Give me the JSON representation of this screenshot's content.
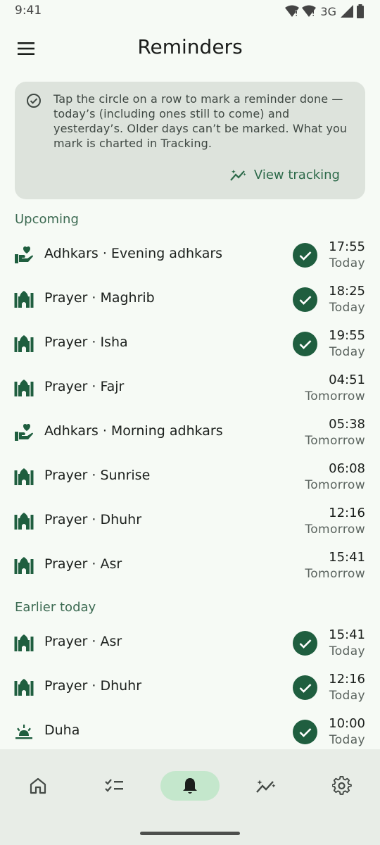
{
  "status_bar": {
    "time": "9:41",
    "network": "3G"
  },
  "app_bar": {
    "title": "Reminders"
  },
  "info_card": {
    "text": "Tap the circle on a row to mark a reminder done — today’s (including ones still to come) and yesterday’s. Older days can’t be marked. What you mark is charted in Tracking.",
    "action_label": "View tracking"
  },
  "sections": {
    "upcoming": "Upcoming",
    "earlier_today": "Earlier today"
  },
  "rows": [
    {
      "icon": "adhkar-icon",
      "label": "Adhkars · Evening adhkars",
      "time": "17:55",
      "day": "Today",
      "done": true
    },
    {
      "icon": "mosque-icon",
      "label": "Prayer · Maghrib",
      "time": "18:25",
      "day": "Today",
      "done": true
    },
    {
      "icon": "mosque-icon",
      "label": "Prayer · Isha",
      "time": "19:55",
      "day": "Today",
      "done": true
    },
    {
      "icon": "mosque-icon",
      "label": "Prayer · Fajr",
      "time": "04:51",
      "day": "Tomorrow",
      "done": false
    },
    {
      "icon": "adhkar-icon",
      "label": "Adhkars · Morning adhkars",
      "time": "05:38",
      "day": "Tomorrow",
      "done": false
    },
    {
      "icon": "mosque-icon",
      "label": "Prayer · Sunrise",
      "time": "06:08",
      "day": "Tomorrow",
      "done": false
    },
    {
      "icon": "mosque-icon",
      "label": "Prayer · Dhuhr",
      "time": "12:16",
      "day": "Tomorrow",
      "done": false
    },
    {
      "icon": "mosque-icon",
      "label": "Prayer · Asr",
      "time": "15:41",
      "day": "Tomorrow",
      "done": false
    },
    {
      "icon": "mosque-icon",
      "label": "Prayer · Asr",
      "time": "15:41",
      "day": "Today",
      "done": true
    },
    {
      "icon": "mosque-icon",
      "label": "Prayer · Dhuhr",
      "time": "12:16",
      "day": "Today",
      "done": true
    },
    {
      "icon": "sunrise-icon",
      "label": "Duha",
      "time": "10:00",
      "day": "Today",
      "done": true
    }
  ],
  "bottom_nav": [
    {
      "icon": "home-icon",
      "active": false
    },
    {
      "icon": "checklist-icon",
      "active": false
    },
    {
      "icon": "bell-icon",
      "active": true
    },
    {
      "icon": "tracking-icon",
      "active": false
    },
    {
      "icon": "settings-icon",
      "active": false
    }
  ],
  "colors": {
    "accent": "#1f5e3f",
    "background": "#f6faf5",
    "card": "#dde3dc",
    "nav_active": "#c4e7cc"
  }
}
